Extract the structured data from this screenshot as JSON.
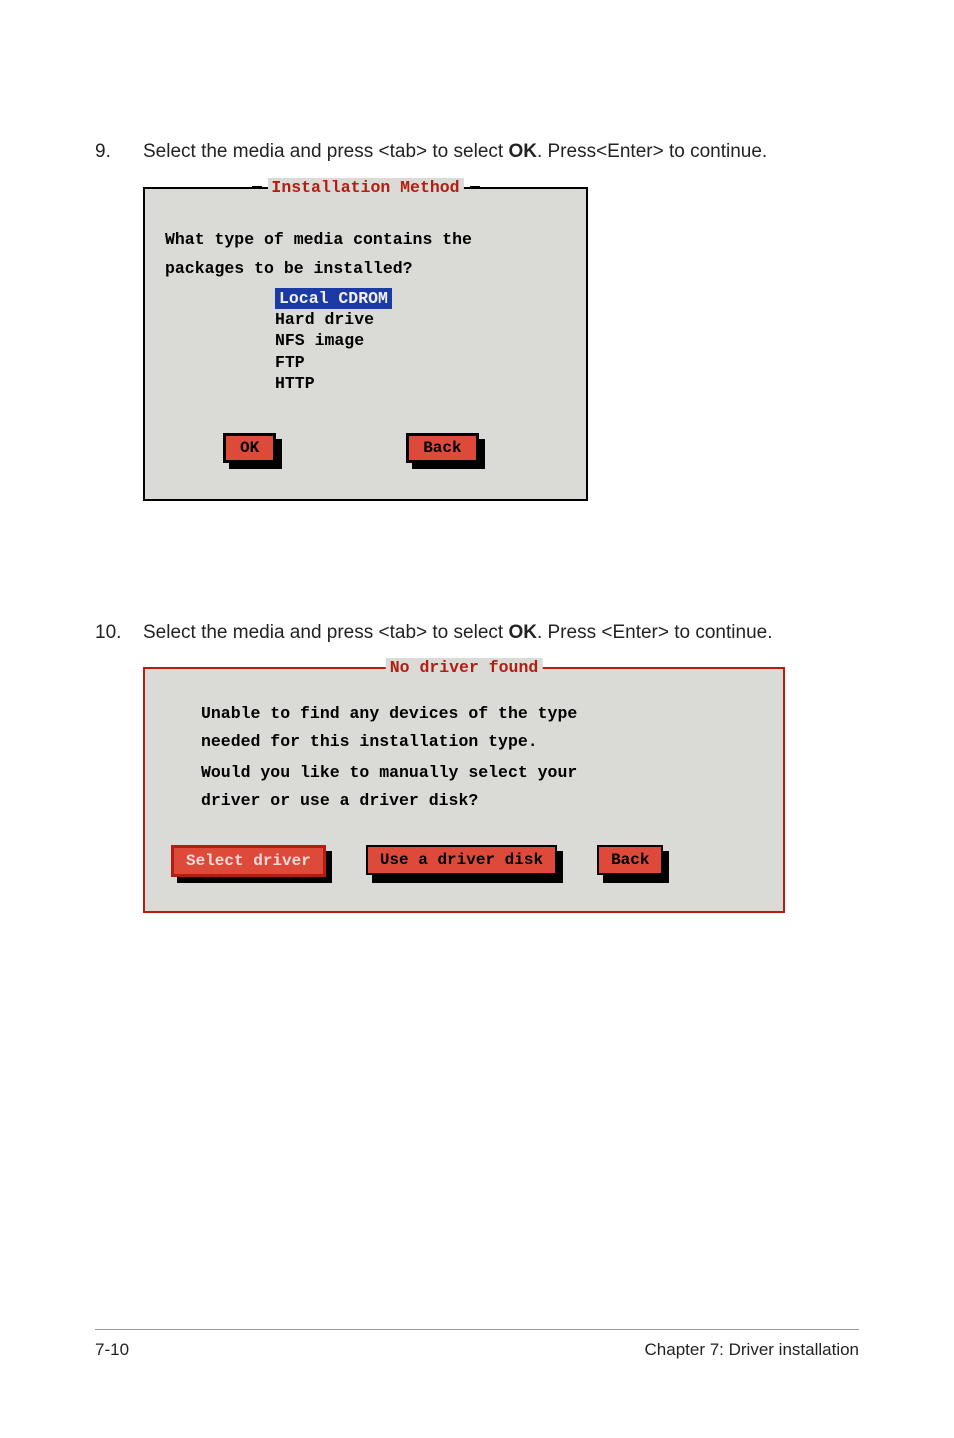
{
  "step9": {
    "num": "9.",
    "text_a": "Select the media and press <tab> to select ",
    "text_bold": "OK",
    "text_b": ". Press<Enter> to continue."
  },
  "dialog1": {
    "title": "Installation Method",
    "question1": "What type of media contains the",
    "question2": "packages to be installed?",
    "options": [
      "Local CDROM",
      "Hard drive",
      "NFS image",
      "FTP",
      "HTTP"
    ],
    "selected_index": 0,
    "buttons": {
      "ok": "OK",
      "back": "Back"
    }
  },
  "step10": {
    "num": "10.",
    "text_a": "Select the media and press <tab> to select ",
    "text_bold": "OK",
    "text_b": ". Press <Enter> to continue."
  },
  "dialog2": {
    "title": "No driver found",
    "msg1": "Unable to find any devices of the type",
    "msg2": "needed for this installation type.",
    "msg3": "Would you like to manually select your",
    "msg4": "driver or use a driver disk?",
    "buttons": {
      "select_driver": "Select driver",
      "use_disk": "Use a driver disk",
      "back": "Back"
    }
  },
  "footer": {
    "page": "7-10",
    "chapter": "Chapter 7: Driver installation"
  }
}
